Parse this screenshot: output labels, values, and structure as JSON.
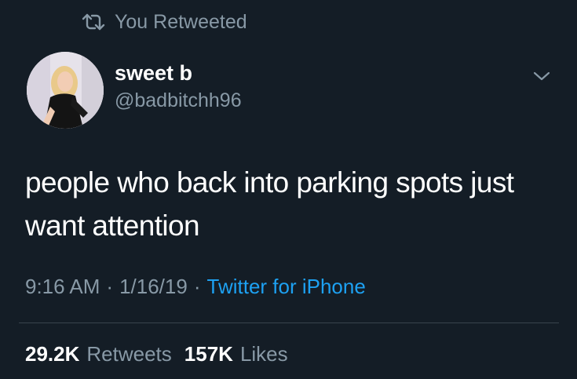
{
  "retweet_context": {
    "label": "You Retweeted",
    "icon": "retweet-icon"
  },
  "author": {
    "display_name": "sweet b",
    "handle": "@badbitchh96",
    "avatar_icon": "avatar-photo"
  },
  "menu": {
    "icon": "chevron-down-icon"
  },
  "tweet": {
    "text": "people who back into parking spots just want attention"
  },
  "meta": {
    "time": "9:16 AM",
    "separator": "·",
    "date": "1/16/19",
    "source": "Twitter for iPhone"
  },
  "stats": {
    "retweets_count": "29.2K",
    "retweets_label": "Retweets",
    "likes_count": "157K",
    "likes_label": "Likes"
  },
  "colors": {
    "background": "#141d26",
    "text_primary": "#ffffff",
    "text_secondary": "#8899a6",
    "link": "#1da1f2",
    "divider": "#38444d"
  }
}
